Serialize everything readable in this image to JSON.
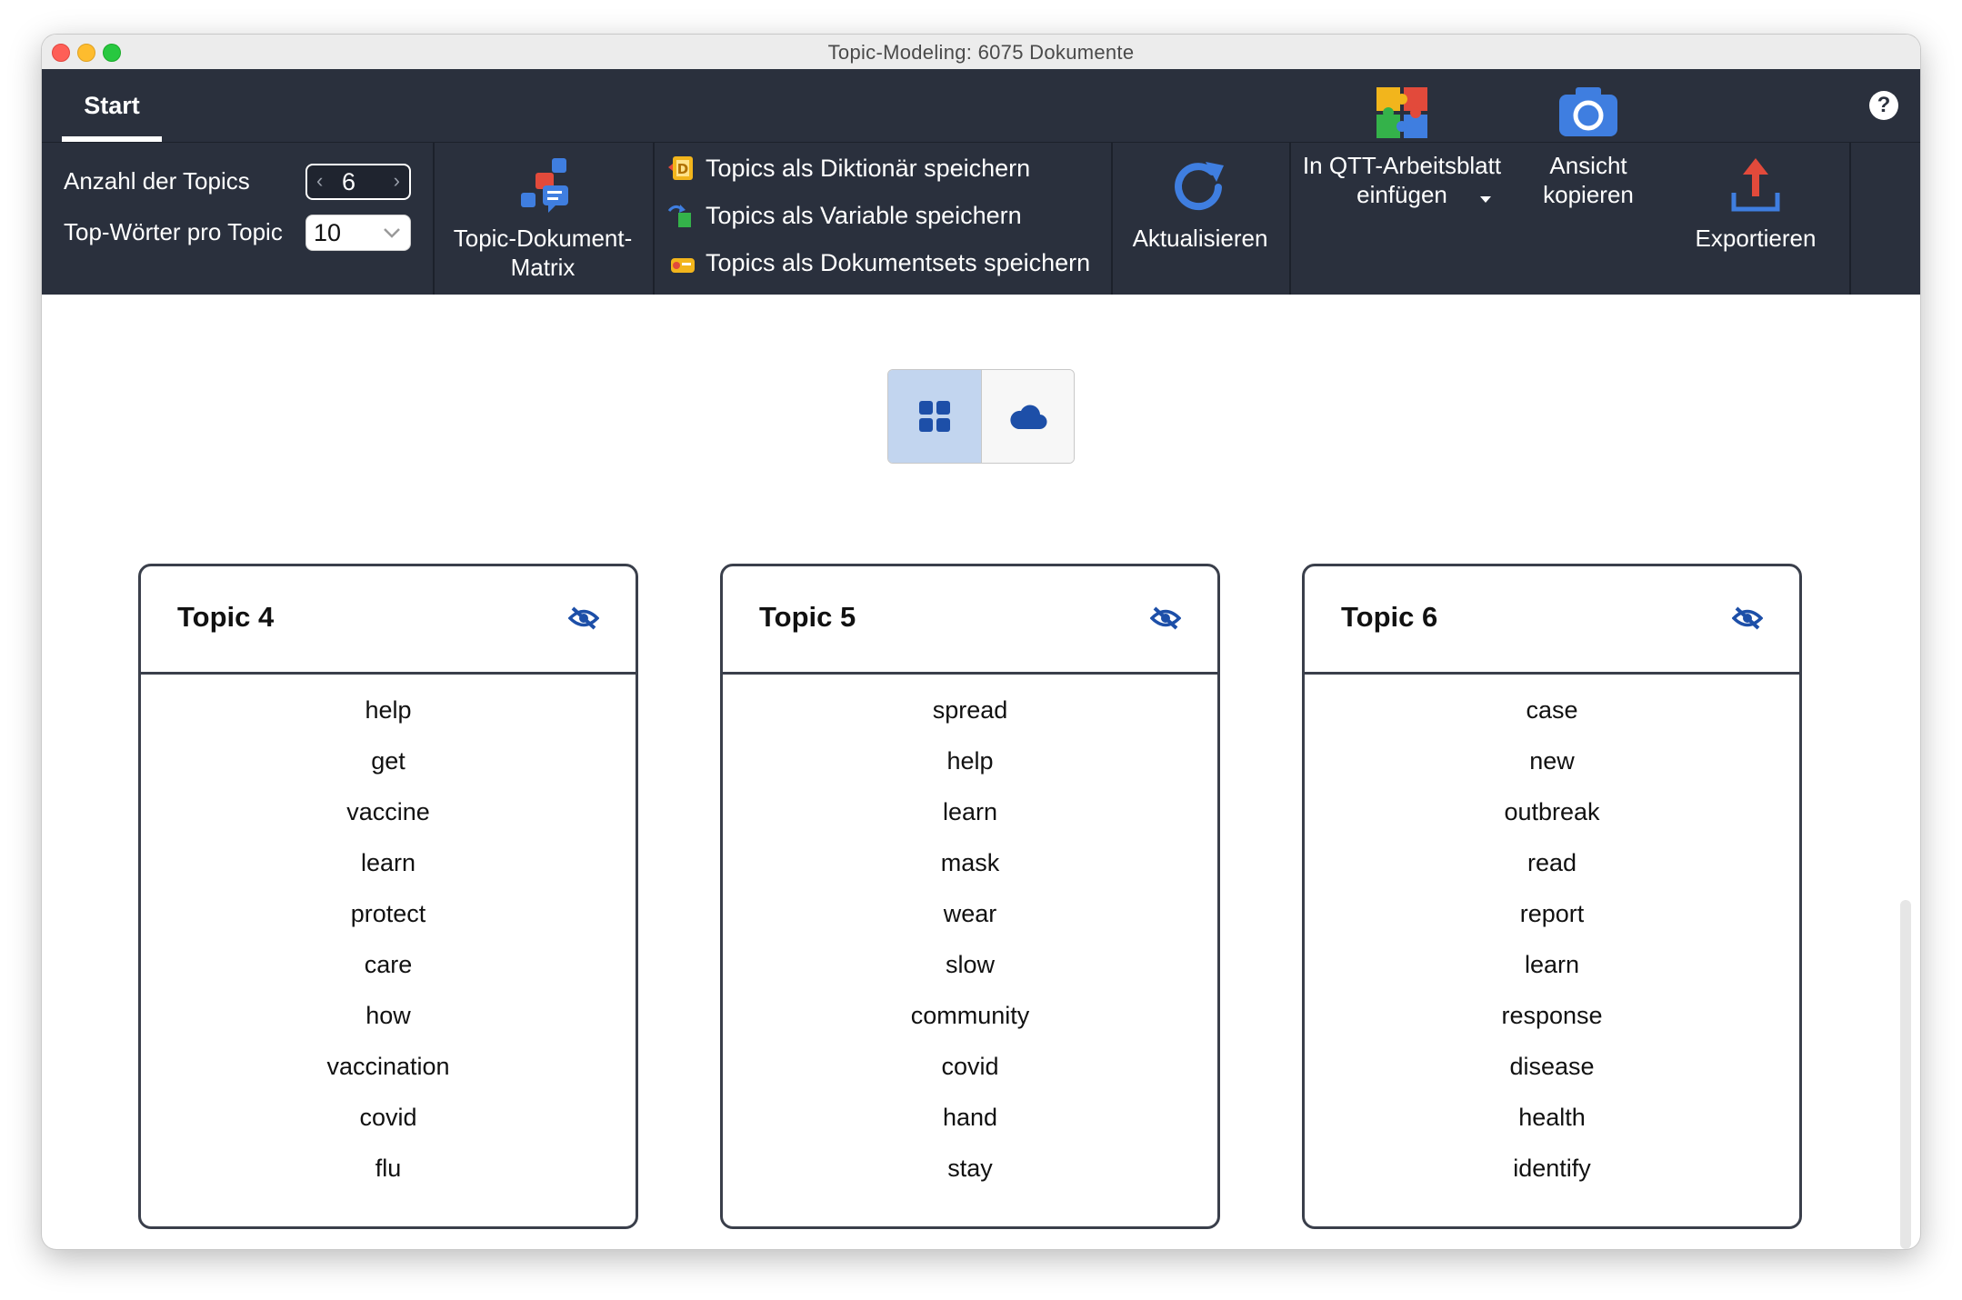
{
  "window": {
    "title": "Topic-Modeling: 6075 Dokumente"
  },
  "ribbon": {
    "tab": "Start",
    "help": "?",
    "settings": {
      "topics_label": "Anzahl der Topics",
      "topics_value": "6",
      "words_label": "Top-Wörter pro Topic",
      "words_value": "10"
    },
    "matrix": {
      "line1": "Topic-Dokument-",
      "line2": "Matrix"
    },
    "save": {
      "dictionary": "Topics als Diktionär speichern",
      "variable": "Topics als Variable speichern",
      "docsets": "Topics als Dokumentsets speichern"
    },
    "refresh": "Aktualisieren",
    "qtt": {
      "line1": "In QTT-Arbeitsblatt",
      "line2": "einfügen"
    },
    "copy": {
      "line1": "Ansicht",
      "line2": "kopieren"
    },
    "export": "Exportieren"
  },
  "view_toggle": {
    "active": "grid",
    "options": [
      "grid-icon",
      "cloud-icon"
    ]
  },
  "accent_color": "#1d4fa8",
  "topics": [
    {
      "title": "Topic 4",
      "words": [
        "help",
        "get",
        "vaccine",
        "learn",
        "protect",
        "care",
        "how",
        "vaccination",
        "covid",
        "flu"
      ]
    },
    {
      "title": "Topic 5",
      "words": [
        "spread",
        "help",
        "learn",
        "mask",
        "wear",
        "slow",
        "community",
        "covid",
        "hand",
        "stay"
      ]
    },
    {
      "title": "Topic 6",
      "words": [
        "case",
        "new",
        "outbreak",
        "read",
        "report",
        "learn",
        "response",
        "disease",
        "health",
        "identify"
      ]
    }
  ]
}
